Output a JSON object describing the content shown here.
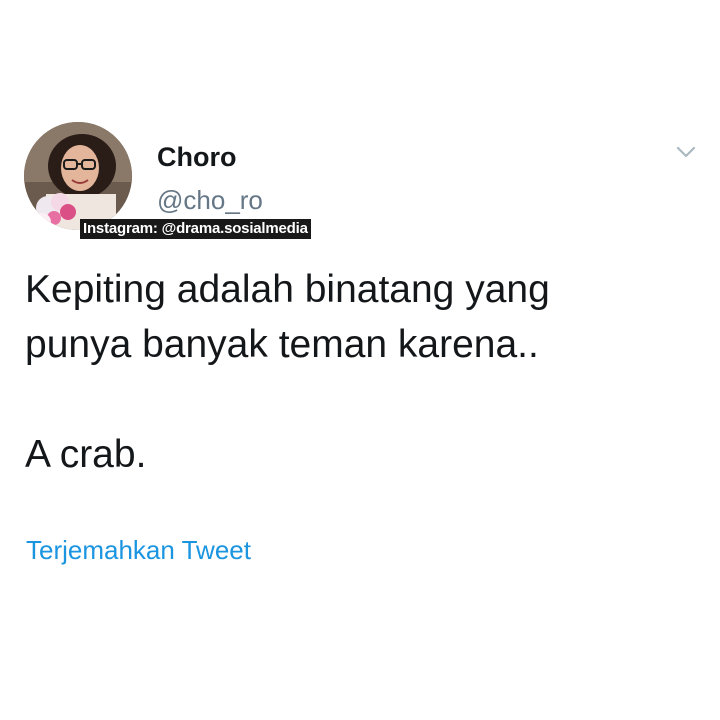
{
  "user": {
    "display_name": "Choro",
    "handle": "@cho_ro"
  },
  "watermark": "Instagram: @drama.sosialmedia",
  "tweet": {
    "text": "Kepiting adalah binatang yang\npunya banyak teman karena..\n\nA crab.",
    "translate_label": "Terjemahkan Tweet"
  },
  "icons": {
    "menu": "chevron-down-icon"
  },
  "colors": {
    "text": "#14171a",
    "secondary": "#657786",
    "link": "#1b95e0",
    "background": "#ffffff"
  }
}
